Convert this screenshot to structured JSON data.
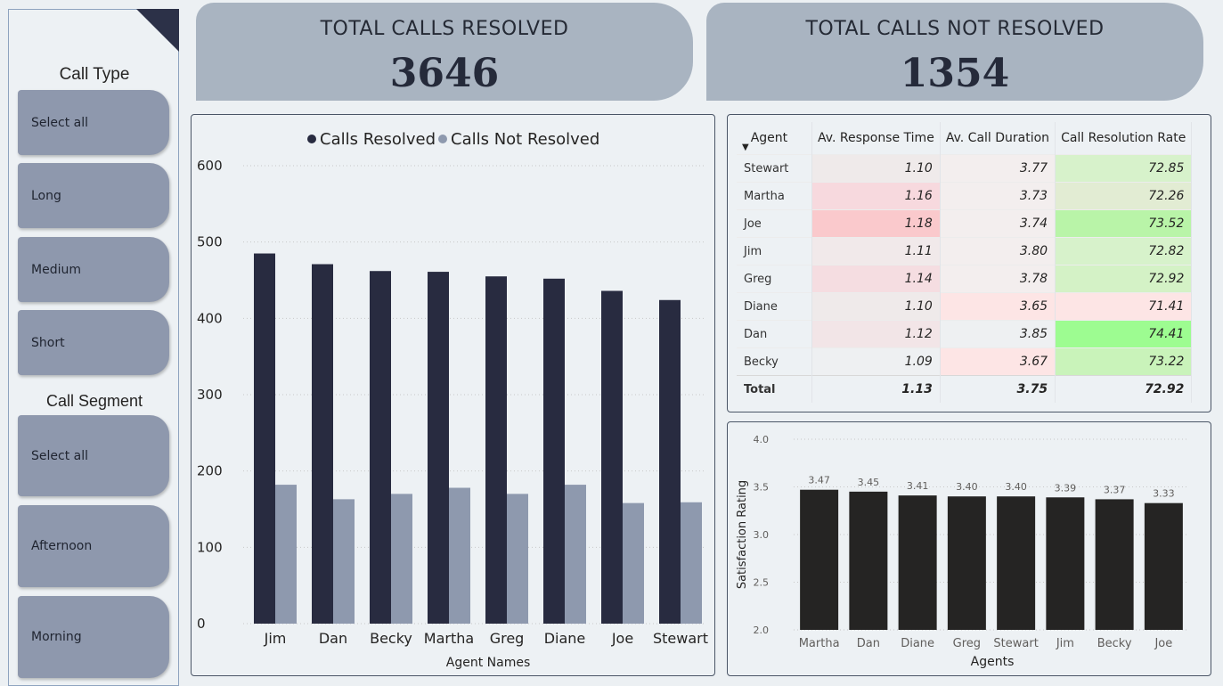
{
  "slicers": {
    "call_type": {
      "title": "Call Type",
      "items": [
        "Select all",
        "Long",
        "Medium",
        "Short"
      ]
    },
    "call_segment": {
      "title": "Call Segment",
      "items": [
        "Select all",
        "Afternoon",
        "Morning"
      ]
    }
  },
  "kpis": {
    "resolved": {
      "label": "TOTAL CALLS RESOLVED",
      "value": "3646"
    },
    "not_resolved": {
      "label": "TOTAL CALLS NOT RESOLVED",
      "value": "1354"
    }
  },
  "table": {
    "headers": [
      "Agent",
      "Av. Response Time",
      "Av. Call Duration",
      "Call Resolution Rate"
    ],
    "rows": [
      [
        "Stewart",
        "1.10",
        "3.77",
        "72.85"
      ],
      [
        "Martha",
        "1.16",
        "3.73",
        "72.26"
      ],
      [
        "Joe",
        "1.18",
        "3.74",
        "73.52"
      ],
      [
        "Jim",
        "1.11",
        "3.80",
        "72.82"
      ],
      [
        "Greg",
        "1.14",
        "3.78",
        "72.92"
      ],
      [
        "Diane",
        "1.10",
        "3.65",
        "71.41"
      ],
      [
        "Dan",
        "1.12",
        "3.85",
        "74.41"
      ],
      [
        "Becky",
        "1.09",
        "3.67",
        "73.22"
      ]
    ],
    "total": [
      "Total",
      "1.13",
      "3.75",
      "72.92"
    ],
    "cell_colors": [
      [
        "#efeaea",
        "#f3eeee",
        "#d7f2cb"
      ],
      [
        "#f7d9de",
        "#f3eeee",
        "#e2ecd3"
      ],
      [
        "#fac9cc",
        "#f3eeee",
        "#b9f4a8"
      ],
      [
        "#f1e9ea",
        "#f3eeee",
        "#d7f2cb"
      ],
      [
        "#f5dde1",
        "#f3eeee",
        "#d4f2c6"
      ],
      [
        "#efeaea",
        "#fde5e5",
        "#fde5e5"
      ],
      [
        "#f2e5e7",
        "#eef0f2",
        "#9dfc91"
      ],
      [
        "#eef0f2",
        "#fde5e5",
        "#c9f3ba"
      ]
    ]
  },
  "chart_data": [
    {
      "type": "bar",
      "categories": [
        "Jim",
        "Dan",
        "Becky",
        "Martha",
        "Greg",
        "Diane",
        "Joe",
        "Stewart"
      ],
      "series": [
        {
          "name": "Calls Resolved",
          "color": "#282b40",
          "values": [
            485,
            471,
            462,
            461,
            455,
            452,
            436,
            424
          ]
        },
        {
          "name": "Calls Not Resolved",
          "color": "#8e99ae",
          "values": [
            182,
            163,
            170,
            178,
            170,
            182,
            158,
            159
          ]
        }
      ],
      "xlabel": "Agent Names",
      "ylabel": "",
      "ylim": [
        0,
        600
      ],
      "yticks": [
        "0",
        "100",
        "200",
        "300",
        "400",
        "500",
        "600"
      ],
      "legend": "top-center",
      "grid": true
    },
    {
      "type": "bar",
      "categories": [
        "Martha",
        "Dan",
        "Diane",
        "Greg",
        "Stewart",
        "Jim",
        "Becky",
        "Joe"
      ],
      "values": [
        3.47,
        3.45,
        3.41,
        3.4,
        3.4,
        3.39,
        3.37,
        3.33
      ],
      "labels": [
        "3.47",
        "3.45",
        "3.41",
        "3.40",
        "3.40",
        "3.39",
        "3.37",
        "3.33"
      ],
      "color": "#252423",
      "xlabel": "Agents",
      "ylabel": "Satisfaction Rating",
      "ylim": [
        2.0,
        4.0
      ],
      "yticks": [
        "2.0",
        "2.5",
        "3.0",
        "3.5",
        "4.0"
      ],
      "grid": true
    }
  ]
}
